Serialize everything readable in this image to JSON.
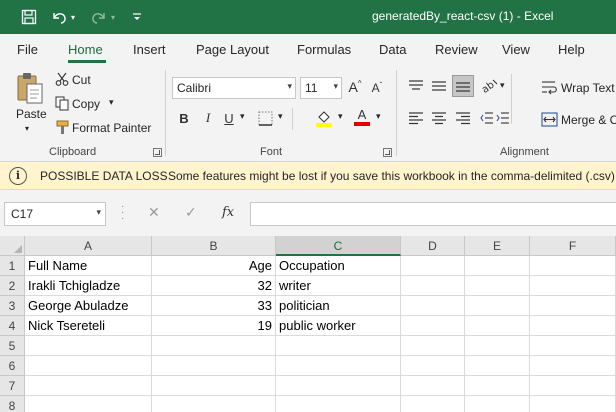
{
  "window": {
    "title": "generatedBy_react-csv (1)  -  Excel"
  },
  "menu": {
    "tabs": [
      "File",
      "Home",
      "Insert",
      "Page Layout",
      "Formulas",
      "Data",
      "Review",
      "View",
      "Help"
    ],
    "active": "Home"
  },
  "ribbon": {
    "clipboard": {
      "paste": "Paste",
      "cut": "Cut",
      "copy": "Copy",
      "format_painter": "Format Painter",
      "label": "Clipboard"
    },
    "font": {
      "family": "Calibri",
      "size": "11",
      "bold": "B",
      "italic": "I",
      "underline": "U",
      "label": "Font",
      "fill_color": "#ffff00",
      "font_color": "#e00000"
    },
    "alignment": {
      "wrap_text": "Wrap Text",
      "merge": "Merge & C",
      "label": "Alignment"
    }
  },
  "infobar": {
    "title": "POSSIBLE DATA LOSS",
    "message": "Some features might be lost if you save this workbook in the comma-delimited (.csv)"
  },
  "formula_bar": {
    "name_box": "C17",
    "cancel": "✕",
    "enter": "✓",
    "fx": "fx",
    "value": ""
  },
  "sheet": {
    "columns": [
      "A",
      "B",
      "C",
      "D",
      "E",
      "F"
    ],
    "selected_column": "C",
    "rows": [
      {
        "n": "1",
        "cells": [
          "Full Name",
          "Age",
          "Occupation",
          "",
          "",
          ""
        ]
      },
      {
        "n": "2",
        "cells": [
          "Irakli Tchigladze",
          "32",
          "writer",
          "",
          "",
          ""
        ]
      },
      {
        "n": "3",
        "cells": [
          "George Abuladze",
          "33",
          "politician",
          "",
          "",
          ""
        ]
      },
      {
        "n": "4",
        "cells": [
          "Nick Tsereteli",
          "19",
          "public worker",
          "",
          "",
          ""
        ]
      },
      {
        "n": "5",
        "cells": [
          "",
          "",
          "",
          "",
          "",
          ""
        ]
      },
      {
        "n": "6",
        "cells": [
          "",
          "",
          "",
          "",
          "",
          ""
        ]
      },
      {
        "n": "7",
        "cells": [
          "",
          "",
          "",
          "",
          "",
          ""
        ]
      },
      {
        "n": "8",
        "cells": [
          "",
          "",
          "",
          "",
          "",
          ""
        ]
      }
    ],
    "numeric_columns": [
      1
    ]
  }
}
